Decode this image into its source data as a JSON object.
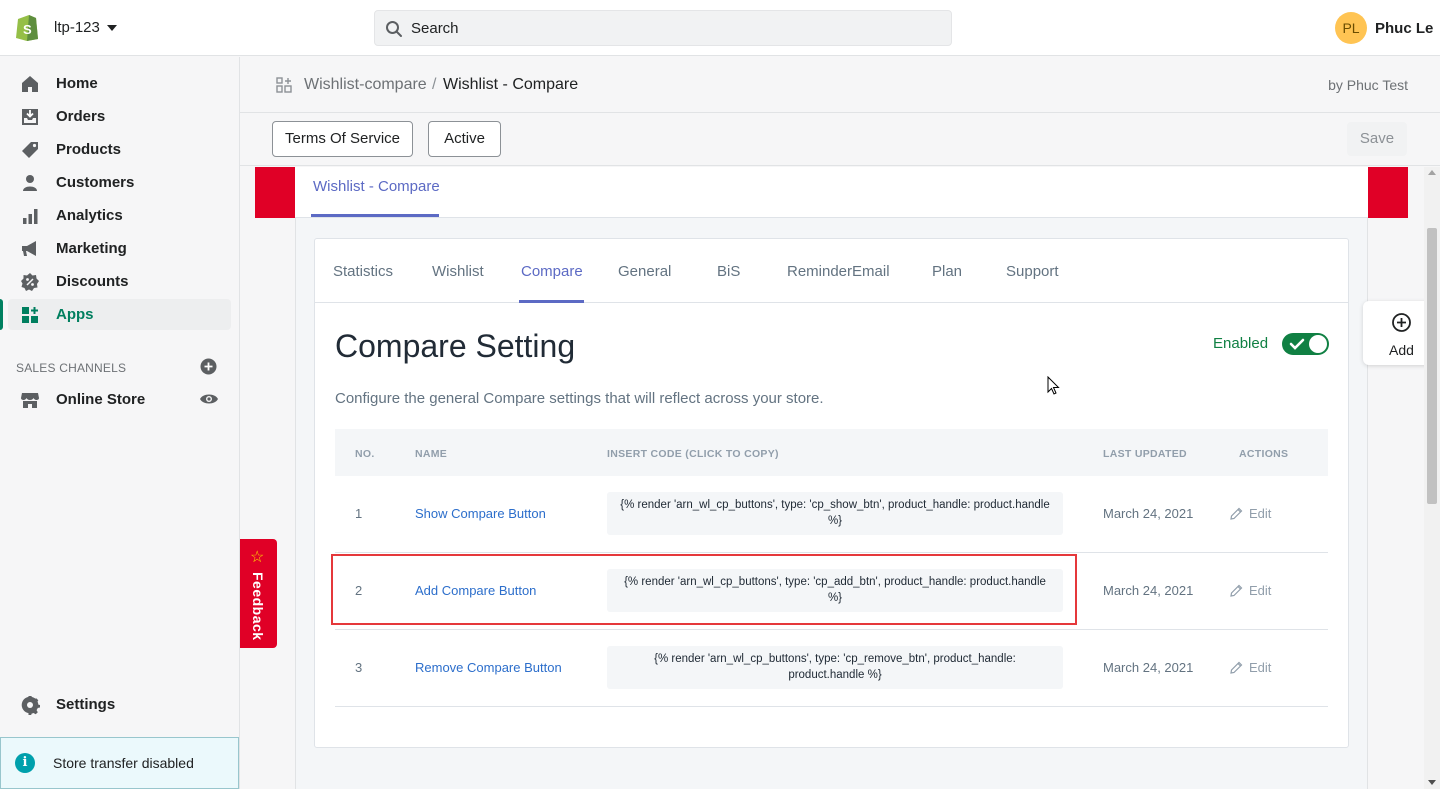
{
  "topbar": {
    "store_name": "ltp-123",
    "search_placeholder": "Search",
    "user_initials": "PL",
    "user_name": "Phuc Le"
  },
  "sidebar": {
    "items": [
      {
        "label": "Home",
        "icon": "home-icon"
      },
      {
        "label": "Orders",
        "icon": "orders-icon"
      },
      {
        "label": "Products",
        "icon": "tag-icon"
      },
      {
        "label": "Customers",
        "icon": "person-icon"
      },
      {
        "label": "Analytics",
        "icon": "bar-chart-icon"
      },
      {
        "label": "Marketing",
        "icon": "megaphone-icon"
      },
      {
        "label": "Discounts",
        "icon": "discount-icon"
      },
      {
        "label": "Apps",
        "icon": "apps-icon",
        "active": true
      }
    ],
    "sales_channels_title": "SALES CHANNELS",
    "online_store": "Online Store",
    "settings": "Settings",
    "store_transfer": "Store transfer disabled"
  },
  "header": {
    "breadcrumb_app": "Wishlist-compare",
    "breadcrumb_sep": "/",
    "breadcrumb_page": "Wishlist - Compare",
    "by": "by Phuc Test"
  },
  "actions": {
    "terms": "Terms Of Service",
    "active": "Active",
    "save": "Save"
  },
  "app": {
    "top_tab": "Wishlist - Compare",
    "tabs": [
      "Statistics",
      "Wishlist",
      "Compare",
      "General",
      "BiS",
      "ReminderEmail",
      "Plan",
      "Support"
    ],
    "active_tab": "Compare",
    "title": "Compare Setting",
    "enabled_label": "Enabled",
    "enabled": true,
    "description": "Configure the general Compare settings that will reflect across your store.",
    "table": {
      "headers": [
        "NO.",
        "NAME",
        "INSERT CODE (CLICK TO COPY)",
        "LAST UPDATED",
        "ACTIONS"
      ],
      "rows": [
        {
          "no": "1",
          "name": "Show Compare Button",
          "code": "{% render 'arn_wl_cp_buttons', type: 'cp_show_btn', product_handle: product.handle %}",
          "date": "March 24, 2021",
          "action": "Edit"
        },
        {
          "no": "2",
          "name": "Add Compare Button",
          "code": "{% render 'arn_wl_cp_buttons', type: 'cp_add_btn', product_handle: product.handle %}",
          "date": "March 24, 2021",
          "action": "Edit"
        },
        {
          "no": "3",
          "name": "Remove Compare Button",
          "code": "{% render 'arn_wl_cp_buttons', type: 'cp_remove_btn', product_handle: product.handle %}",
          "date": "March 24, 2021",
          "action": "Edit"
        }
      ]
    }
  },
  "feedback": "Feedback",
  "add_button": "Add",
  "colors": {
    "shopify_green": "#008060",
    "accent_indigo": "#5c6ac4",
    "link_blue": "#2c6ecb",
    "brand_red": "#e00026",
    "highlight_red": "#e5383b"
  }
}
